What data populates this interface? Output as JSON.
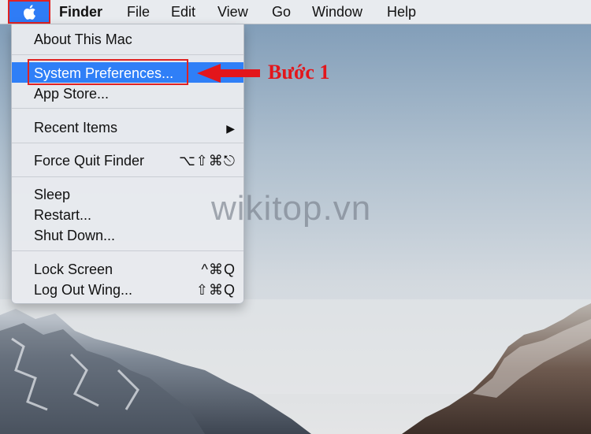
{
  "menubar": {
    "apple_icon": "apple-logo-icon",
    "items": [
      "Finder",
      "File",
      "Edit",
      "View",
      "Go",
      "Window",
      "Help"
    ]
  },
  "apple_menu": {
    "about": "About This Mac",
    "system_prefs": "System Preferences...",
    "app_store": "App Store...",
    "recent_items": "Recent Items",
    "recent_items_arrow": "▶",
    "force_quit": "Force Quit Finder",
    "force_quit_shortcut": "⌥⇧⌘⎋",
    "sleep": "Sleep",
    "restart": "Restart...",
    "shut_down": "Shut Down...",
    "lock_screen": "Lock Screen",
    "lock_screen_shortcut": "^⌘Q",
    "log_out": "Log Out Wing...",
    "log_out_shortcut": "⇧⌘Q"
  },
  "annotation": {
    "step_label": "Bước 1",
    "watermark": "wikitop.vn"
  },
  "colors": {
    "highlight": "#2f7ff7",
    "annotation_red": "#e02222"
  }
}
